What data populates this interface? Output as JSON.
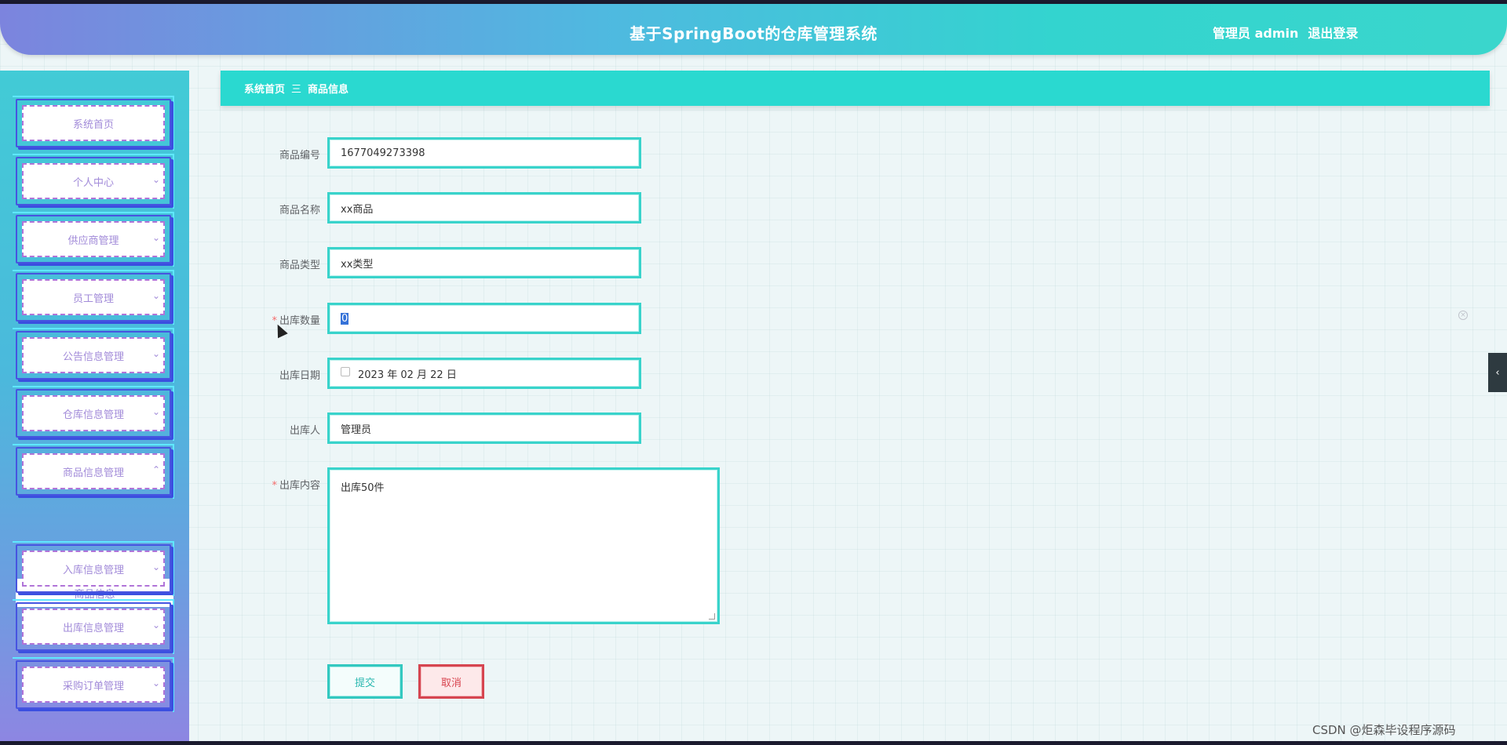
{
  "header": {
    "title": "基于SpringBoot的仓库管理系统",
    "user_label": "管理员 admin",
    "logout_label": "退出登录"
  },
  "sidebar": {
    "items": [
      {
        "label": "系统首页",
        "has_chevron": false
      },
      {
        "label": "个人中心",
        "has_chevron": true
      },
      {
        "label": "供应商管理",
        "has_chevron": true
      },
      {
        "label": "员工管理",
        "has_chevron": true
      },
      {
        "label": "公告信息管理",
        "has_chevron": true
      },
      {
        "label": "仓库信息管理",
        "has_chevron": true
      },
      {
        "label": "商品信息管理",
        "has_chevron": true,
        "expanded": true
      },
      {
        "label": "入库信息管理",
        "has_chevron": true
      },
      {
        "label": "出库信息管理",
        "has_chevron": true
      },
      {
        "label": "采购订单管理",
        "has_chevron": true
      }
    ],
    "submenu": {
      "label": "商品信息"
    }
  },
  "breadcrumb": {
    "home": "系统首页",
    "separator": "三",
    "current": "商品信息"
  },
  "form": {
    "product_code": {
      "label": "商品编号",
      "value": "1677049273398"
    },
    "product_name": {
      "label": "商品名称",
      "value": "xx商品"
    },
    "product_type": {
      "label": "商品类型",
      "value": "xx类型"
    },
    "out_quantity": {
      "label": "出库数量",
      "value": "0",
      "required": true
    },
    "out_date": {
      "label": "出库日期",
      "value": "2023 年 02 月 22 日"
    },
    "out_person": {
      "label": "出库人",
      "value": "管理员"
    },
    "out_content": {
      "label": "出库内容",
      "value": "出库50件",
      "required": true
    }
  },
  "buttons": {
    "submit": "提交",
    "cancel": "取消"
  },
  "icons": {
    "chevron_down": "⌄",
    "chevron_up": "⌃",
    "panel_toggle": "‹",
    "clear": "×"
  },
  "watermark": "CSDN @炬森毕设程序源码",
  "colors": {
    "accent": "#2ad9d0",
    "menu_border": "#4754e0",
    "menu_text": "#a28bd9",
    "cancel": "#d64550"
  }
}
